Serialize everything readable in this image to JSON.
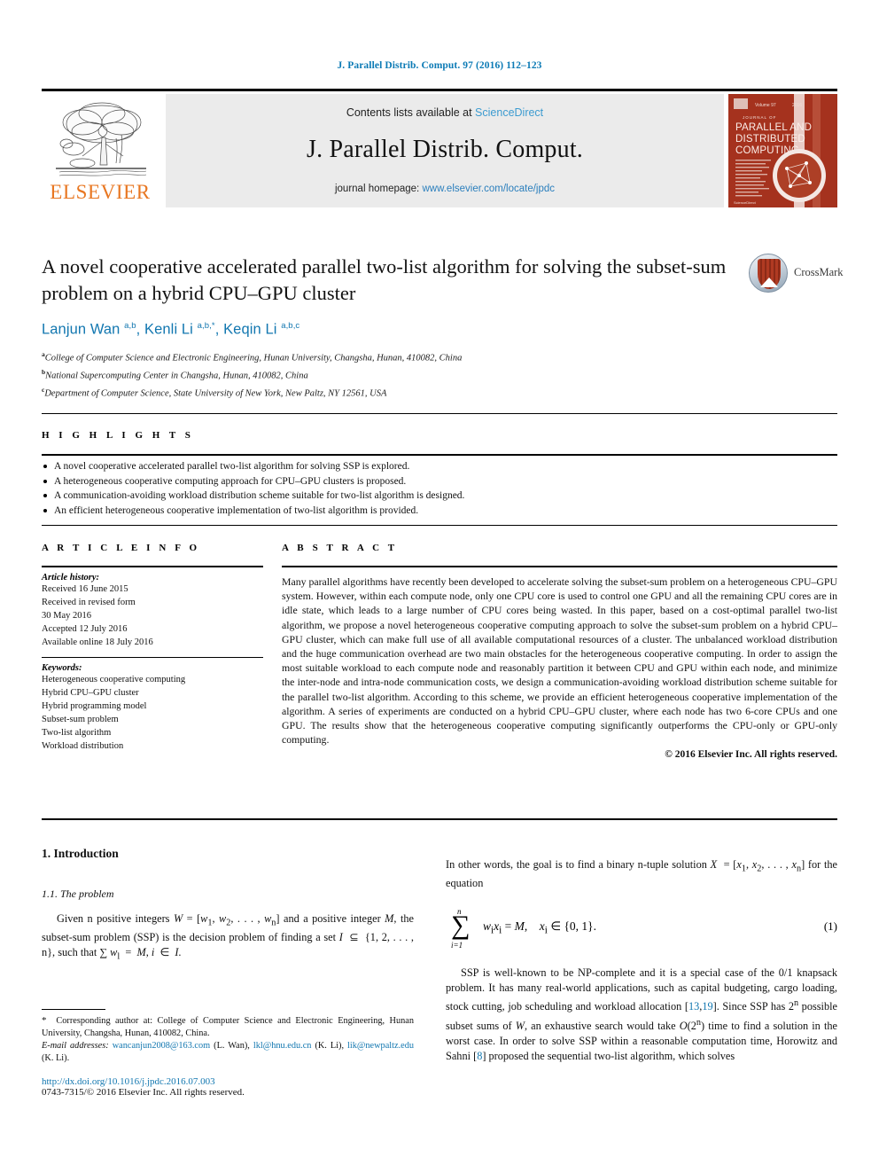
{
  "running_head": "J. Parallel Distrib. Comput. 97 (2016) 112–123",
  "masthead": {
    "publisher_name": "ELSEVIER",
    "contents_prefix": "Contents lists available at ",
    "contents_link": "ScienceDirect",
    "journal_name": "J. Parallel Distrib. Comput.",
    "homepage_prefix": "journal homepage: ",
    "homepage_link": "www.elsevier.com/locate/jpdc",
    "cover_lines": [
      "JOURNAL OF",
      "PARALLEL AND",
      "DISTRIBUTED",
      "COMPUTING"
    ]
  },
  "title": "A novel cooperative accelerated parallel two-list algorithm for solving the subset-sum problem on a hybrid CPU–GPU cluster",
  "crossmark_label": "CrossMark",
  "authors_html": "Lanjun Wan <sup>a,b</sup>, Kenli Li <sup>a,b,</sup><sup>*</sup>, Keqin Li <sup>a,b,c</sup>",
  "affiliations": [
    {
      "marker": "a",
      "text": "College of Computer Science and Electronic Engineering, Hunan University, Changsha, Hunan, 410082, China"
    },
    {
      "marker": "b",
      "text": "National Supercomputing Center in Changsha, Hunan, 410082, China"
    },
    {
      "marker": "c",
      "text": "Department of Computer Science, State University of New York, New Paltz, NY 12561, USA"
    }
  ],
  "highlights": {
    "heading": "H I G H L I G H T S",
    "items": [
      "A novel cooperative accelerated parallel two-list algorithm for solving SSP is explored.",
      "A heterogeneous cooperative computing approach for CPU–GPU clusters is proposed.",
      "A communication-avoiding workload distribution scheme suitable for two-list algorithm is designed.",
      "An efficient heterogeneous cooperative implementation of two-list algorithm is provided."
    ]
  },
  "article_info": {
    "heading": "A R T I C L E   I N F O",
    "history_label": "Article history:",
    "history_lines": [
      "Received 16 June 2015",
      "Received in revised form",
      "30 May 2016",
      "Accepted 12 July 2016",
      "Available online 18 July 2016"
    ],
    "keywords_label": "Keywords:",
    "keywords": [
      "Heterogeneous cooperative computing",
      "Hybrid CPU–GPU cluster",
      "Hybrid programming model",
      "Subset-sum problem",
      "Two-list algorithm",
      "Workload distribution"
    ]
  },
  "abstract": {
    "heading": "A B S T R A C T",
    "body": "Many parallel algorithms have recently been developed to accelerate solving the subset-sum problem on a heterogeneous CPU–GPU system. However, within each compute node, only one CPU core is used to control one GPU and all the remaining CPU cores are in idle state, which leads to a large number of CPU cores being wasted. In this paper, based on a cost-optimal parallel two-list algorithm, we propose a novel heterogeneous cooperative computing approach to solve the subset-sum problem on a hybrid CPU–GPU cluster, which can make full use of all available computational resources of a cluster. The unbalanced workload distribution and the huge communication overhead are two main obstacles for the heterogeneous cooperative computing. In order to assign the most suitable workload to each compute node and reasonably partition it between CPU and GPU within each node, and minimize the inter-node and intra-node communication costs, we design a communication-avoiding workload distribution scheme suitable for the parallel two-list algorithm. According to this scheme, we provide an efficient heterogeneous cooperative implementation of the algorithm. A series of experiments are conducted on a hybrid CPU–GPU cluster, where each node has two 6-core CPUs and one GPU. The results show that the heterogeneous cooperative computing significantly outperforms the CPU-only or GPU-only computing.",
    "copyright": "© 2016 Elsevier Inc. All rights reserved."
  },
  "body": {
    "section_1": "1. Introduction",
    "subsection_1_1": "1.1. The problem",
    "left_par_1_html": "Given n positive integers <i>W</i> = [<i>w</i><sub>1</sub>, <i>w</i><sub>2</sub>, . . . , <i>w</i><sub>n</sub>] and a positive integer <i>M</i>, the subset-sum problem (SSP) is the decision problem of finding a set <i>I</i> &nbsp;⊆&nbsp; {1, 2, . . . , n}, such that ∑ <i>w</i><sub>l</sub> &nbsp;=&nbsp; <i>M</i>, <i>i</i> &nbsp;∈&nbsp; <i>I</i>.",
    "right_par_1_html": "In other words, the goal is to find a binary n-tuple solution <i>X</i> &nbsp;= [<i>x</i><sub>1</sub>, <i>x</i><sub>2</sub>, . . . , <i>x</i><sub>n</sub>] for the equation",
    "equation": {
      "sigma": "∑",
      "upper_limit": "n",
      "lower_limit": "i=1",
      "expression_html": "<i>w</i><sub>i</sub><i>x</i><sub>i</sub> = <i>M</i>, &nbsp;&nbsp; <i>x</i><sub>i</sub> ∈ {0, 1}.",
      "number": "(1)"
    },
    "right_par_2_html": "SSP is well-known to be NP-complete and it is a special case of the 0/1 knapsack problem. It has many real-world applications, such as capital budgeting, cargo loading, stock cutting, job scheduling and workload allocation [<span class=\"ref-link\">13</span>,<span class=\"ref-link\">19</span>]. Since SSP has 2<sup>n</sup> possible subset sums of <i>W</i>, an exhaustive search would take <i>O</i>(2<sup>n</sup>) time to find a solution in the worst case. In order to solve SSP within a reasonable computation time, Horowitz and Sahni [<span class=\"ref-link\">8</span>] proposed the sequential two-list algorithm, which solves"
  },
  "footnote": {
    "corresponding_html": "<span class=\"fn-star\">*</span> &nbsp;Corresponding author at: College of Computer Science and Electronic Engineering, Hunan University, Changsha, Hunan, 410082, China.",
    "emails_html": "<span class=\"fn-email-label\">E-mail addresses:</span> <span class=\"fn-link\">wancanjun2008@163.com</span> (L. Wan), <span class=\"fn-link\">lkl@hnu.edu.cn</span> (K. Li), <span class=\"fn-link\">lik@newpaltz.edu</span> (K. Li).",
    "doi": "http://dx.doi.org/10.1016/j.jpdc.2016.07.003",
    "issn": "0743-7315/© 2016 Elsevier Inc. All rights reserved."
  },
  "colors": {
    "link_blue": "#1277b0",
    "sciencedirect_blue": "#3c9bd0",
    "elsevier_orange": "#e87722",
    "cover_red": "#a5321e"
  }
}
